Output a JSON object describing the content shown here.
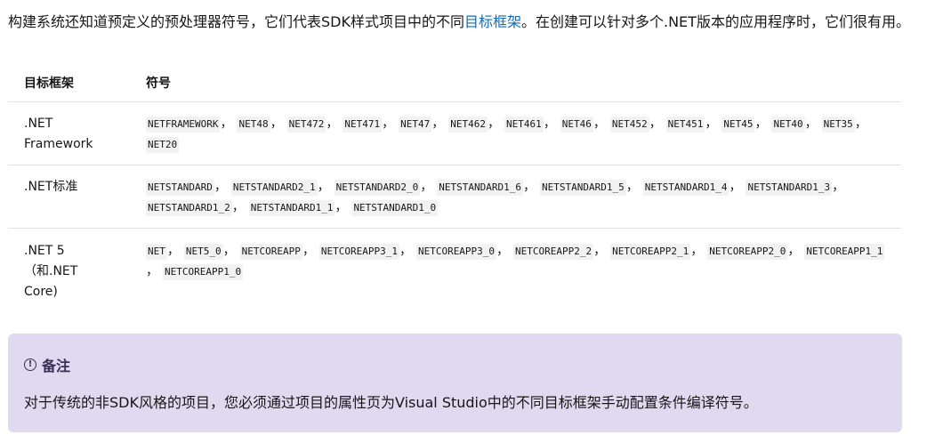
{
  "intro": {
    "text_before": "构建系统还知道预定义的预处理器符号，它们代表SDK样式项目中的不同",
    "link_text": "目标框架",
    "text_after": "。在创建可以针对多个.NET版本的应用程序时，它们很有用。"
  },
  "table": {
    "headers": {
      "framework": "目标框架",
      "symbols": "符号"
    },
    "rows": [
      {
        "framework": ".NET Framework",
        "symbols": [
          "NETFRAMEWORK",
          "NET48",
          "NET472",
          "NET471",
          "NET47",
          "NET462",
          "NET461",
          "NET46",
          "NET452",
          "NET451",
          "NET45",
          "NET40",
          "NET35",
          "NET20"
        ]
      },
      {
        "framework": ".NET标准",
        "symbols": [
          "NETSTANDARD",
          "NETSTANDARD2_1",
          "NETSTANDARD2_0",
          "NETSTANDARD1_6",
          "NETSTANDARD1_5",
          "NETSTANDARD1_4",
          "NETSTANDARD1_3",
          "NETSTANDARD1_2",
          "NETSTANDARD1_1",
          "NETSTANDARD1_0"
        ]
      },
      {
        "framework": ".NET 5 （和.NET Core)",
        "symbols": [
          "NET",
          "NET5_0",
          "NETCOREAPP",
          "NETCOREAPP3_1",
          "NETCOREAPP3_0",
          "NETCOREAPP2_2",
          "NETCOREAPP2_1",
          "NETCOREAPP2_0",
          "NETCOREAPP1_1",
          "NETCOREAPP1_0"
        ]
      }
    ],
    "separator": "，"
  },
  "note": {
    "icon": "info-icon",
    "title": "备注",
    "body": "对于传统的非SDK风格的项目，您必须通过项目的属性页为Visual Studio中的不同目标框架手动配置条件编译符号。"
  },
  "colors": {
    "link": "#0f6cbd",
    "note_background": "#e1d9ef",
    "note_title": "#3b2e58",
    "code_background": "#f2f2f2"
  }
}
